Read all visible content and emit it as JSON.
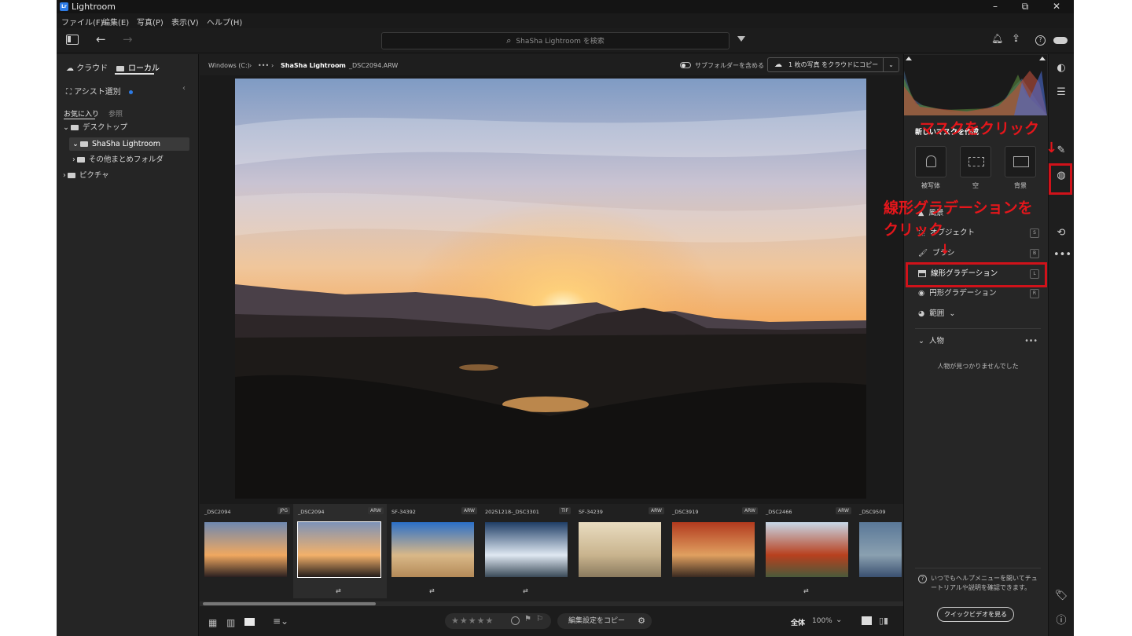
{
  "window": {
    "title": "Lightroom",
    "minimize": "–",
    "maximize": "⧉",
    "close": "✕"
  },
  "menu": [
    "ファイル(F)",
    "編集(E)",
    "写真(P)",
    "表示(V)",
    "ヘルプ(H)"
  ],
  "toolbar": {
    "search_placeholder": "ShaSha Lightroom を検索"
  },
  "left": {
    "tab_cloud": "クラウド",
    "tab_local": "ローカル",
    "assist": "アシスト選別",
    "subtab_fav": "お気に入り",
    "subtab_browse": "参照",
    "tree": [
      "デスクトップ",
      "ShaSha Lightroom",
      "その他まとめフォルダ",
      "ピクチャ"
    ]
  },
  "breadcrumb": {
    "drive": "Windows (C:)",
    "more": "•••",
    "folder": "ShaSha Lightroom",
    "file": "_DSC2094.ARW",
    "subfolder_toggle": "サブフォルダーを含める",
    "copy_to_cloud": "1 枚の写真 をクラウドにコピー"
  },
  "filmstrip": [
    {
      "name": "_DSC2094",
      "ext": "JPG"
    },
    {
      "name": "_DSC2094",
      "ext": "ARW"
    },
    {
      "name": "SF-34392",
      "ext": "ARW"
    },
    {
      "name": "20251218-_DSC3301",
      "ext": "TIF"
    },
    {
      "name": "SF-34239",
      "ext": "ARW"
    },
    {
      "name": "_DSC3919",
      "ext": "ARW"
    },
    {
      "name": "_DSC2466",
      "ext": "ARW"
    },
    {
      "name": "_DSC9509",
      "ext": ""
    }
  ],
  "bottombar": {
    "stars": "★★★★★",
    "copy_settings": "編集設定をコピー",
    "fit": "全体",
    "zoom": "100%"
  },
  "masking": {
    "create_new": "新しいマスクを作成",
    "tiles": [
      "被写体",
      "空",
      "背景"
    ],
    "tools": [
      "風景",
      "オブジェクト",
      "ブラシ",
      "線形グラデーション",
      "円形グラデーション",
      "範囲"
    ],
    "tool_keys": [
      "",
      "S",
      "B",
      "L",
      "R",
      ""
    ],
    "people_header": "人物",
    "people_empty": "人物が見つかりませんでした"
  },
  "help": {
    "tip": "いつでもヘルプメニューを開いてチュートリアルや説明を確認できます。",
    "video_button": "クイックビデオを見る"
  },
  "annotations": {
    "mask_click": "マスクをクリック",
    "linear_line1": "線形グラデーションを",
    "linear_line2": "クリック",
    "arrow": "↓"
  },
  "colors": {
    "accent_red": "#e5161b",
    "lr_blue": "#2d7be5"
  }
}
